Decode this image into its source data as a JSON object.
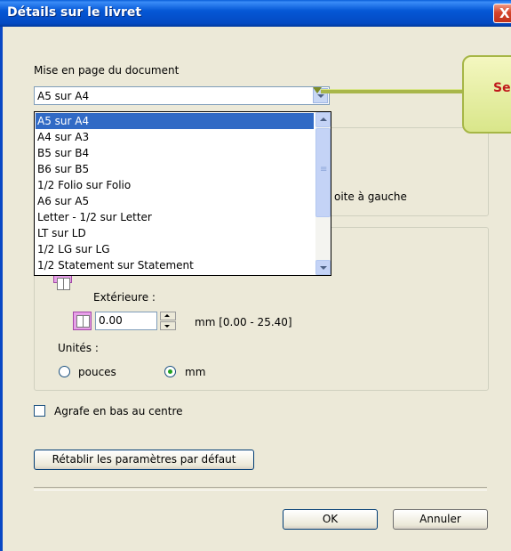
{
  "window": {
    "title": "Détails sur le livret",
    "close_label": "X"
  },
  "layout": {
    "label": "Mise en page du document",
    "selected": "A5 sur A4",
    "options": [
      "A5 sur A4",
      "A4 sur A3",
      "B5 sur B4",
      "B6 sur B5",
      "1/2 Folio sur Folio",
      "A6 sur A5",
      "Letter - 1/2 sur Letter",
      "LT sur LD",
      "1/2 LG sur LG",
      "1/2 Statement sur Statement"
    ]
  },
  "binding": {
    "visible_fragment": "oite à gauche"
  },
  "margins": {
    "outer_label": "Extérieure :",
    "outer_value": "0.00",
    "range": "mm [0.00 - 25.40]"
  },
  "units": {
    "label": "Unités :",
    "inches": "pouces",
    "mm": "mm",
    "selected": "mm"
  },
  "staple": {
    "label": "Agrafe en bas au centre",
    "checked": false
  },
  "buttons": {
    "reset": "Rétablir les paramètres par défaut",
    "ok": "OK",
    "cancel": "Annuler"
  },
  "callout": {
    "text": "Se"
  },
  "colors": {
    "title_bar": "#0558d6",
    "selection": "#316ac5",
    "callout_text": "#c0181b",
    "dialog_bg": "#ece9d8"
  }
}
